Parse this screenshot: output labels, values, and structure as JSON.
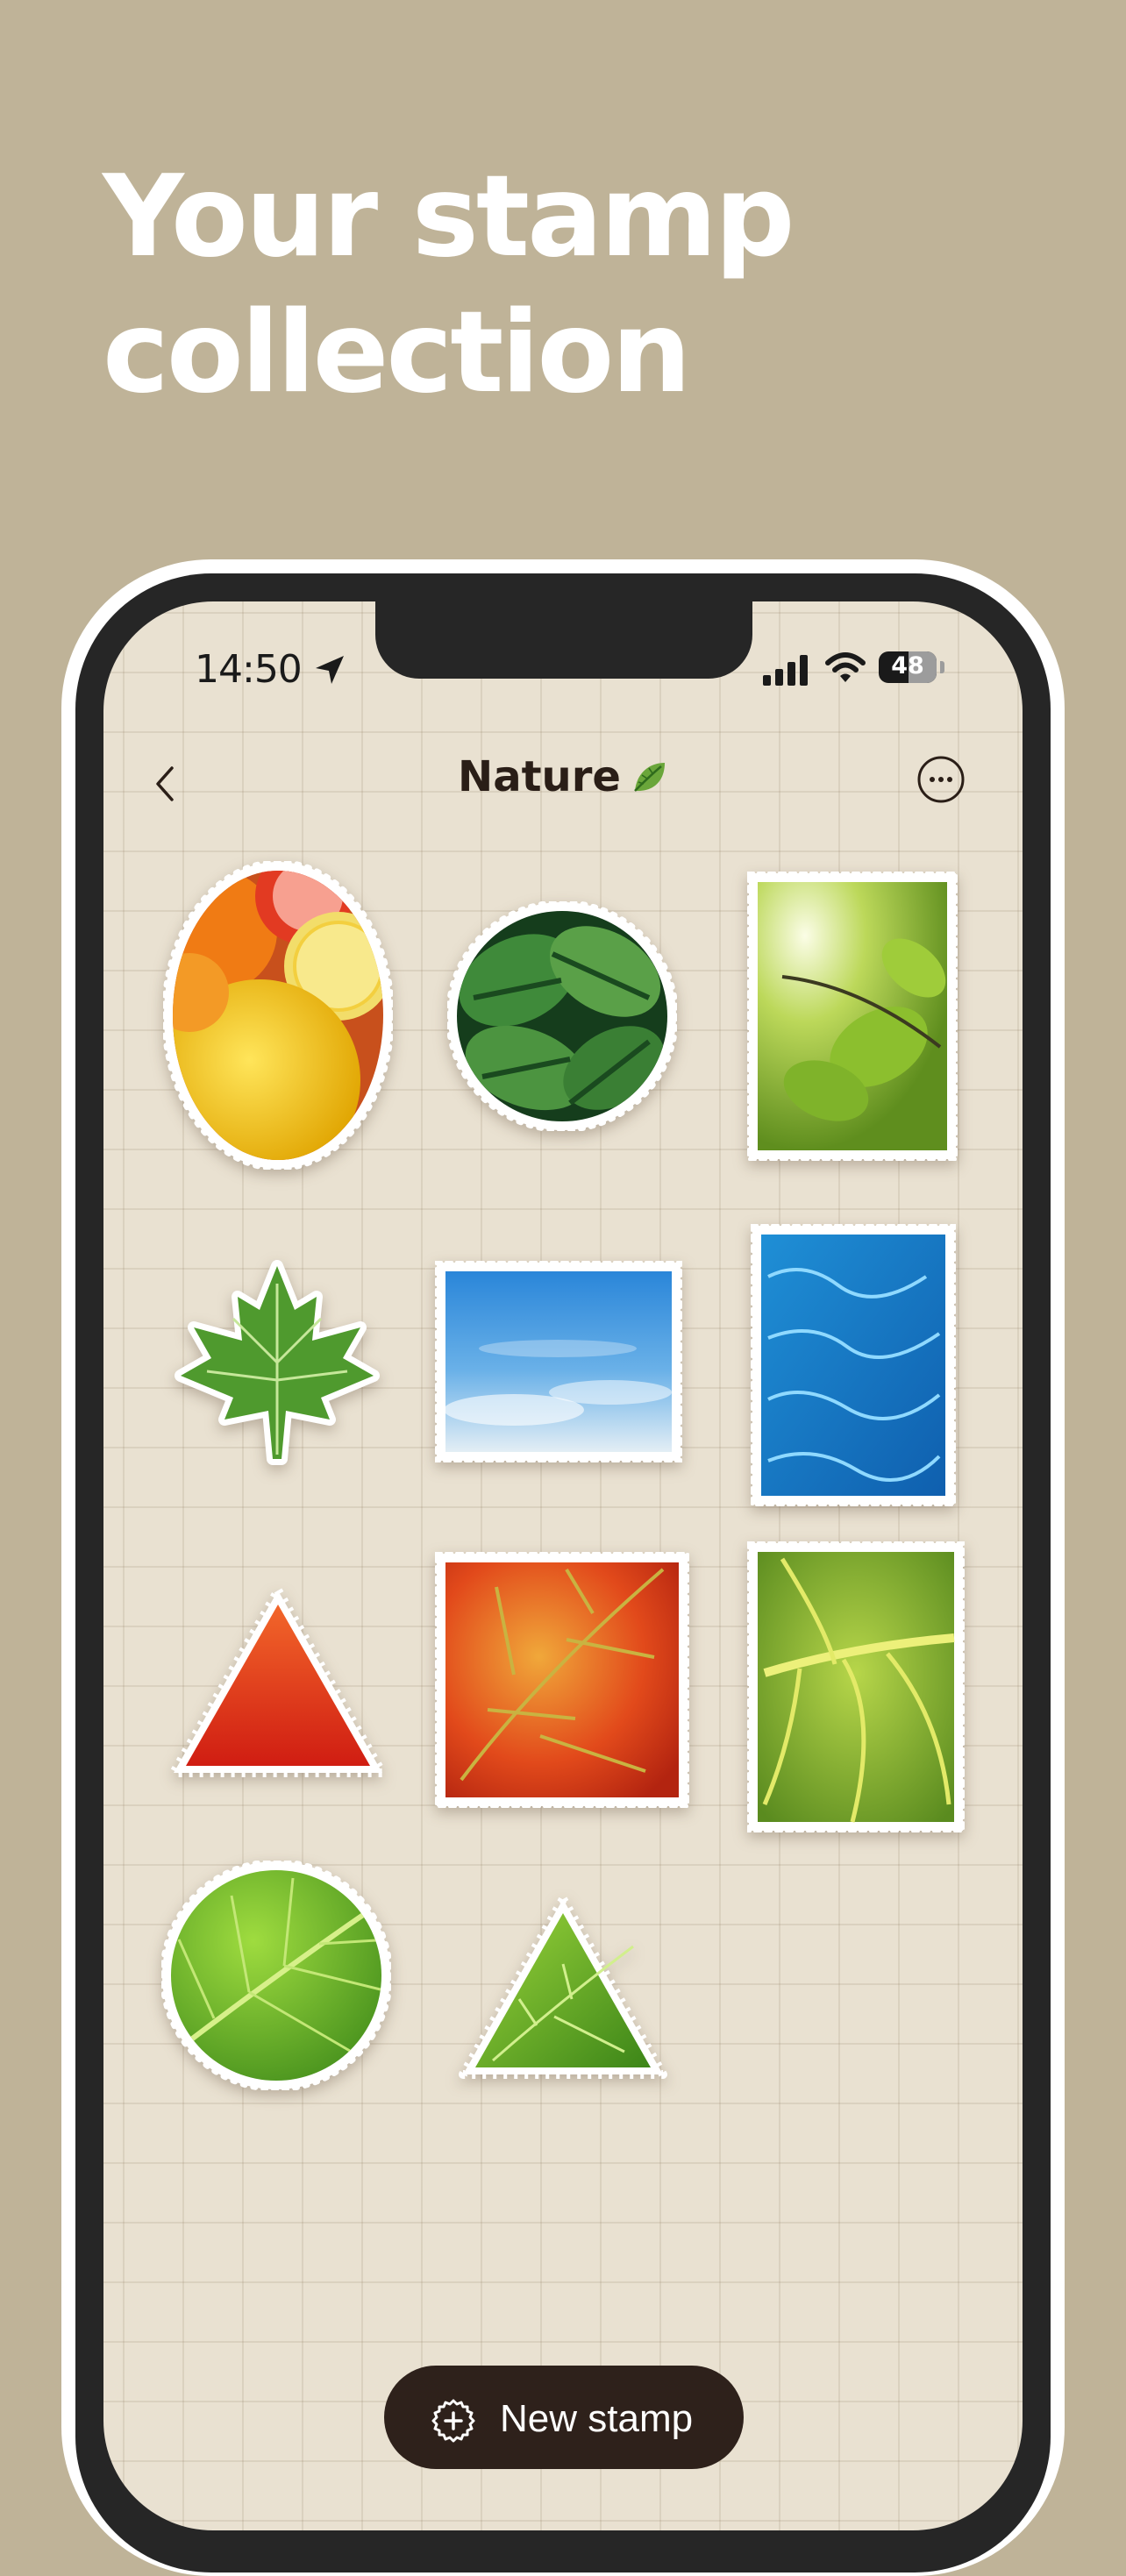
{
  "marketing": {
    "headline_line1": "Your stamp",
    "headline_line2": "collection"
  },
  "status_bar": {
    "time": "14:50",
    "battery": "48"
  },
  "header": {
    "title": "Nature"
  },
  "stamps": [
    {
      "subject": "citrus fruits",
      "shape": "oval"
    },
    {
      "subject": "monstera leaves",
      "shape": "circle"
    },
    {
      "subject": "sunlit green leaves",
      "shape": "rectangle"
    },
    {
      "subject": "maple leaf",
      "shape": "die-cut"
    },
    {
      "subject": "blue sky",
      "shape": "rectangle"
    },
    {
      "subject": "pool water",
      "shape": "rectangle"
    },
    {
      "subject": "red texture",
      "shape": "triangle"
    },
    {
      "subject": "autumn leaf",
      "shape": "square"
    },
    {
      "subject": "green leaf veins",
      "shape": "rectangle"
    },
    {
      "subject": "green leaf",
      "shape": "circle"
    },
    {
      "subject": "green leaf",
      "shape": "triangle"
    }
  ],
  "actions": {
    "new_stamp": "New stamp"
  },
  "colors": {
    "background": "#bfb398",
    "screen": "#e9e1d1",
    "primary_button": "#2e211b",
    "title_text": "#2a1e17"
  }
}
